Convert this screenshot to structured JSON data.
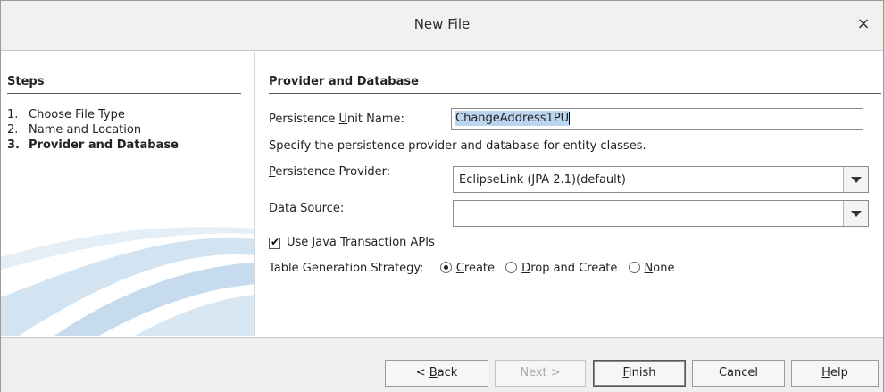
{
  "window": {
    "title": "New File",
    "close_glyph": "×"
  },
  "steps": {
    "heading": "Steps",
    "items": [
      {
        "num": "1.",
        "label": "Choose File Type"
      },
      {
        "num": "2.",
        "label": "Name and Location"
      },
      {
        "num": "3.",
        "label": "Provider and Database",
        "current": true
      }
    ]
  },
  "panel": {
    "heading": "Provider and Database",
    "unit_name": {
      "label_pre": "Persistence ",
      "label_mnemonic": "U",
      "label_post": "nit Name:",
      "value": "ChangeAddress1PU"
    },
    "description": "Specify the persistence provider and database for entity classes.",
    "provider": {
      "label_mnemonic": "P",
      "label_post": "ersistence Provider:",
      "value": "EclipseLink (JPA 2.1)(default)"
    },
    "data_source": {
      "label_pre": "D",
      "label_mnemonic": "a",
      "label_post": "ta Source:",
      "value": ""
    },
    "jta": {
      "checked": true,
      "label_pre": "Use ",
      "label_mnemonic": "J",
      "label_post": "ava Transaction APIs"
    },
    "table_strategy": {
      "label": "Table Generation Strategy:",
      "options": [
        {
          "mnemonic": "C",
          "rest": "reate",
          "selected": true
        },
        {
          "mnemonic": "D",
          "rest": "rop and Create",
          "selected": false
        },
        {
          "mnemonic": "N",
          "rest": "one",
          "selected": false
        }
      ]
    }
  },
  "footer": {
    "back": {
      "pre": "< ",
      "mnemonic": "B",
      "post": "ack"
    },
    "next": "Next >",
    "finish": {
      "mnemonic": "F",
      "post": "inish"
    },
    "cancel": "Cancel",
    "help": {
      "mnemonic": "H",
      "post": "elp"
    }
  },
  "colors": {
    "selection": "#bcd5ee",
    "swoosh": "#c9dcec"
  }
}
